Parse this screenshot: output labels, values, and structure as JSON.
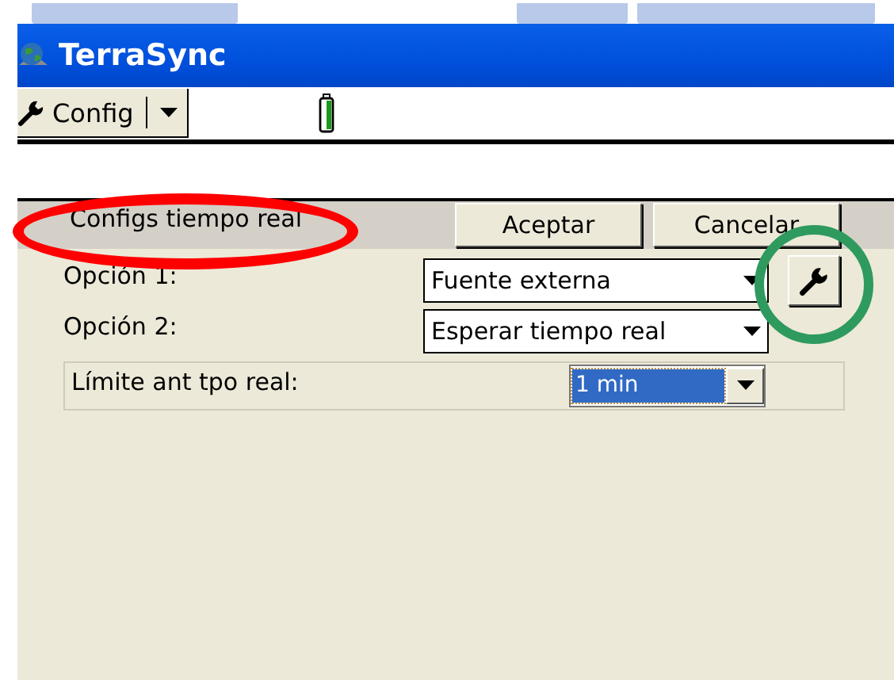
{
  "window": {
    "title": "TerraSync"
  },
  "toolbar": {
    "menu_button": "Config"
  },
  "panel": {
    "title": "Configs tiempo real",
    "buttons": [
      "Aceptar",
      "Cancelar"
    ],
    "options": [
      {
        "label": "Opción 1:",
        "value": "Fuente externa",
        "has_settings": true
      },
      {
        "label": "Opción 2:",
        "value": "Esperar tiempo real",
        "has_settings": false
      }
    ],
    "limit": {
      "label": "Límite ant tpo real:",
      "value": "1 min",
      "focused": true
    }
  },
  "annotations": [
    {
      "kind": "ellipse",
      "color": "#ff0000"
    },
    {
      "kind": "circle",
      "color": "#2e9a5e"
    }
  ]
}
